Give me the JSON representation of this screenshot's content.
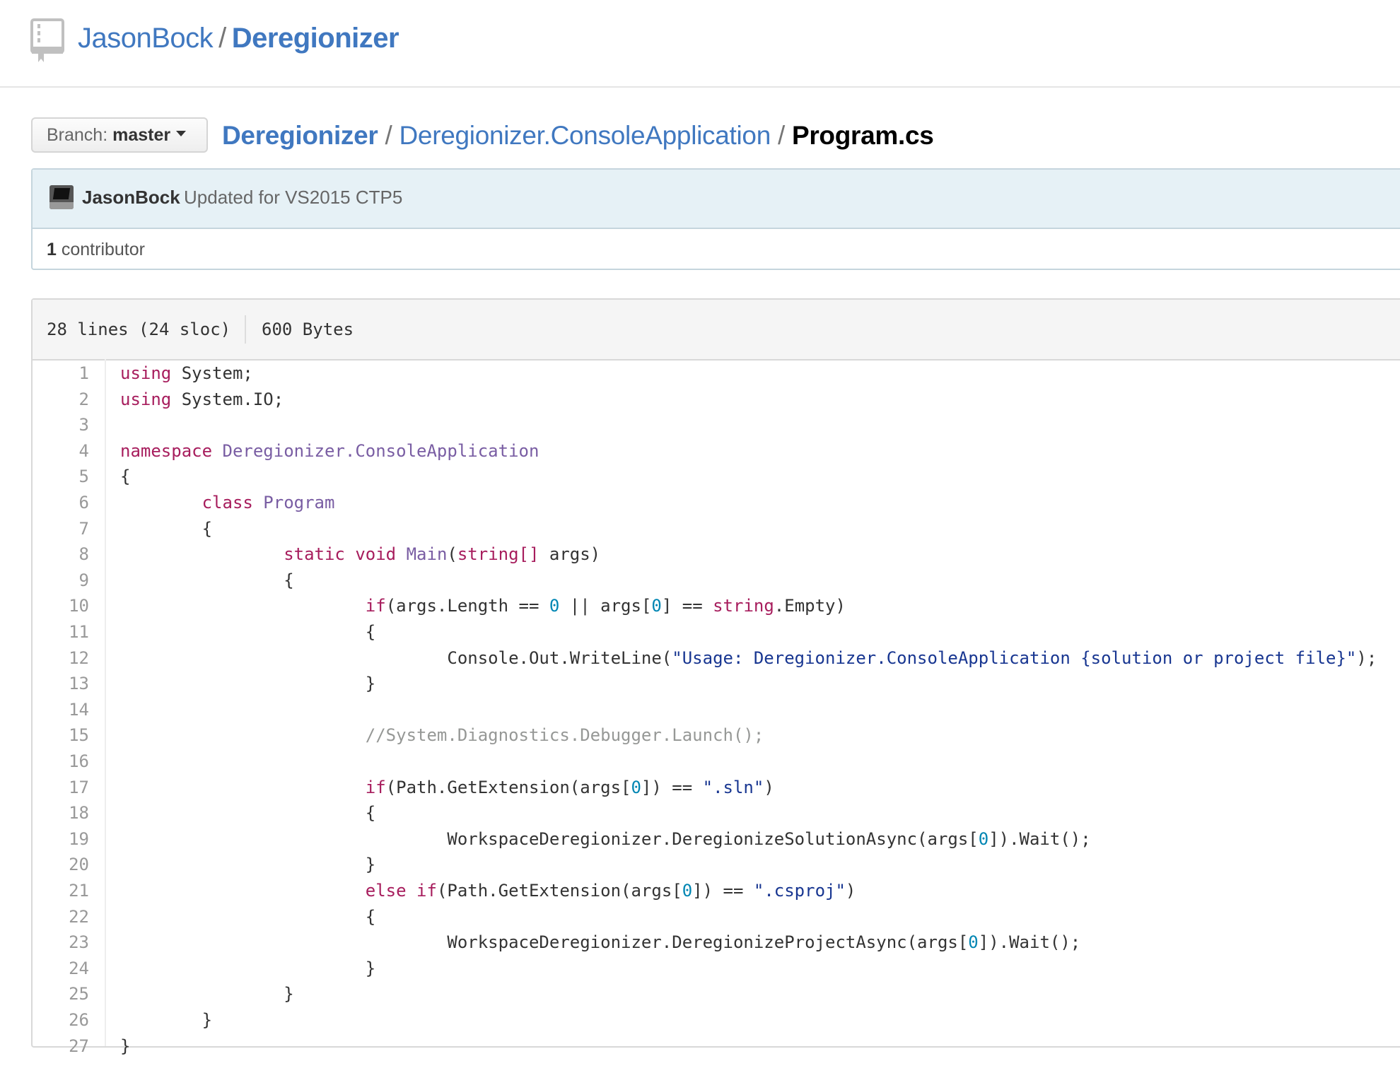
{
  "repo": {
    "owner": "JasonBock",
    "separator": "/",
    "name": "Deregionizer"
  },
  "branch": {
    "label": "Branch:",
    "value": "master"
  },
  "breadcrumb": {
    "root": "Deregionizer",
    "dir": "Deregionizer.ConsoleApplication",
    "file": "Program.cs",
    "separator": "/"
  },
  "commit": {
    "author": "JasonBock",
    "message": "Updated for VS2015 CTP5",
    "contributors_count": "1",
    "contributors_label": "contributor"
  },
  "file_info": {
    "lines": "28 lines (24 sloc)",
    "size": "600 Bytes"
  },
  "code_lines": [
    {
      "n": "1",
      "t": [
        [
          "kw",
          "using"
        ],
        [
          "",
          "System;"
        ]
      ]
    },
    {
      "n": "2",
      "t": [
        [
          "kw",
          "using"
        ],
        [
          "",
          "System.IO;"
        ]
      ]
    },
    {
      "n": "3",
      "t": []
    },
    {
      "n": "4",
      "t": [
        [
          "kw",
          "namespace"
        ],
        [
          "nm",
          "Deregionizer.ConsoleApplication"
        ]
      ]
    },
    {
      "n": "5",
      "t": [
        [
          "",
          "{"
        ]
      ]
    },
    {
      "n": "6",
      "t": [
        [
          "",
          "\t"
        ],
        [
          "kw",
          "class"
        ],
        [
          "nm",
          "Program"
        ]
      ]
    },
    {
      "n": "7",
      "t": [
        [
          "",
          "\t{"
        ]
      ]
    },
    {
      "n": "8",
      "t": [
        [
          "",
          "\t\t"
        ],
        [
          "kw",
          "static void"
        ],
        [
          "nm",
          "Main"
        ],
        [
          "",
          "("
        ],
        [
          "kw",
          "string[]"
        ],
        [
          "",
          "args)"
        ]
      ]
    },
    {
      "n": "9",
      "t": [
        [
          "",
          "\t\t{"
        ]
      ]
    },
    {
      "n": "10",
      "t": [
        [
          "",
          "\t\t\t"
        ],
        [
          "kw",
          "if"
        ],
        [
          "",
          "(args.Length =="
        ],
        [
          "num",
          "0"
        ],
        [
          "",
          "|| args["
        ],
        [
          "num",
          "0"
        ],
        [
          "",
          "] =="
        ],
        [
          "kw",
          "string"
        ],
        [
          "",
          ".Empty)"
        ]
      ]
    },
    {
      "n": "11",
      "t": [
        [
          "",
          "\t\t\t{"
        ]
      ]
    },
    {
      "n": "12",
      "t": [
        [
          "",
          "\t\t\t\tConsole.Out.WriteLine("
        ],
        [
          "str",
          "\"Usage: Deregionizer.ConsoleApplication {solution or project file}\""
        ],
        [
          "",
          ");"
        ]
      ]
    },
    {
      "n": "13",
      "t": [
        [
          "",
          "\t\t\t}"
        ]
      ]
    },
    {
      "n": "14",
      "t": []
    },
    {
      "n": "15",
      "t": [
        [
          "",
          "\t\t\t"
        ],
        [
          "cm",
          "//System.Diagnostics.Debugger.Launch();"
        ]
      ]
    },
    {
      "n": "16",
      "t": []
    },
    {
      "n": "17",
      "t": [
        [
          "",
          "\t\t\t"
        ],
        [
          "kw",
          "if"
        ],
        [
          "",
          "(Path.GetExtension(args["
        ],
        [
          "num",
          "0"
        ],
        [
          "",
          "]) =="
        ],
        [
          "str",
          "\".sln\""
        ],
        [
          "",
          ")"
        ]
      ]
    },
    {
      "n": "18",
      "t": [
        [
          "",
          "\t\t\t{"
        ]
      ]
    },
    {
      "n": "19",
      "t": [
        [
          "",
          "\t\t\t\tWorkspaceDeregionizer.DeregionizeSolutionAsync(args["
        ],
        [
          "num",
          "0"
        ],
        [
          "",
          "]).Wait();"
        ]
      ]
    },
    {
      "n": "20",
      "t": [
        [
          "",
          "\t\t\t}"
        ]
      ]
    },
    {
      "n": "21",
      "t": [
        [
          "",
          "\t\t\t"
        ],
        [
          "kw",
          "else if"
        ],
        [
          "",
          "(Path.GetExtension(args["
        ],
        [
          "num",
          "0"
        ],
        [
          "",
          "]) =="
        ],
        [
          "str",
          "\".csproj\""
        ],
        [
          "",
          ")"
        ]
      ]
    },
    {
      "n": "22",
      "t": [
        [
          "",
          "\t\t\t{"
        ]
      ]
    },
    {
      "n": "23",
      "t": [
        [
          "",
          "\t\t\t\tWorkspaceDeregionizer.DeregionizeProjectAsync(args["
        ],
        [
          "num",
          "0"
        ],
        [
          "",
          "]).Wait();"
        ]
      ]
    },
    {
      "n": "24",
      "t": [
        [
          "",
          "\t\t\t}"
        ]
      ]
    },
    {
      "n": "25",
      "t": [
        [
          "",
          "\t\t}"
        ]
      ]
    },
    {
      "n": "26",
      "t": [
        [
          "",
          "\t}"
        ]
      ]
    },
    {
      "n": "27",
      "t": [
        [
          "",
          "}"
        ]
      ]
    }
  ]
}
